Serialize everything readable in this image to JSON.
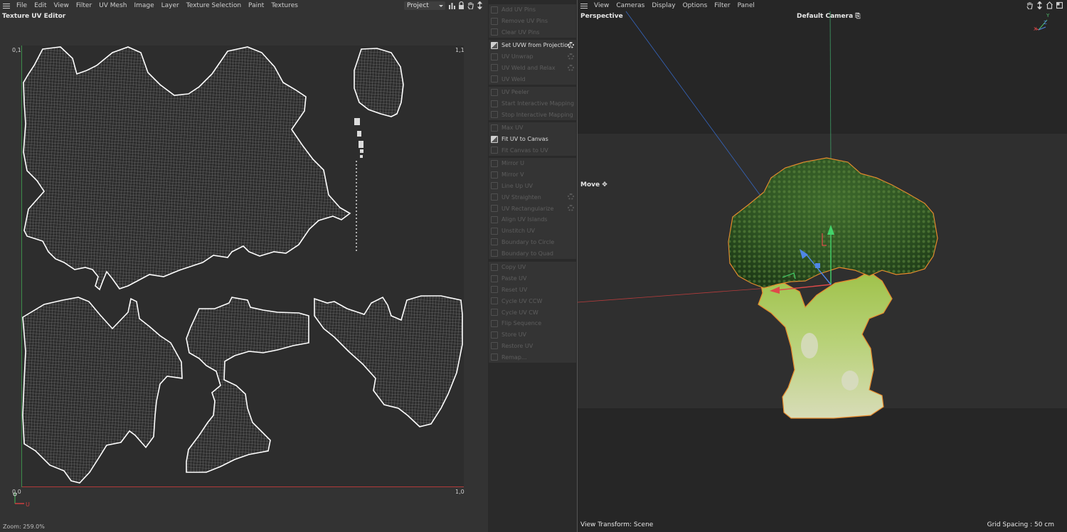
{
  "uv_editor": {
    "menu": [
      "File",
      "Edit",
      "View",
      "Filter",
      "UV Mesh",
      "Image",
      "Layer",
      "Texture Selection",
      "Paint",
      "Textures"
    ],
    "title": "Texture UV Editor",
    "project_select": "Project",
    "corners": {
      "top_left": "0,1",
      "top_right": "1,1",
      "bottom_left": "0,0",
      "bottom_right": "1,0"
    },
    "gizmo_u": "U",
    "zoom": "Zoom: 259.0%",
    "toolbar_icons": [
      "histogram-icon",
      "lock-icon",
      "hand-icon",
      "move-icon"
    ]
  },
  "commands": {
    "groups": [
      [
        {
          "label": "Add UV Pins",
          "active": false,
          "gear": false
        },
        {
          "label": "Remove UV Pins",
          "active": false,
          "gear": false
        },
        {
          "label": "Clear UV Pins",
          "active": false,
          "gear": false
        }
      ],
      [
        {
          "label": "Set UVW from Projection",
          "active": true,
          "gear": true
        },
        {
          "label": "UV Unwrap",
          "active": false,
          "gear": true
        },
        {
          "label": "UV Weld and Relax",
          "active": false,
          "gear": true
        },
        {
          "label": "UV Weld",
          "active": false,
          "gear": false
        }
      ],
      [
        {
          "label": "UV Peeler",
          "active": false,
          "gear": false
        },
        {
          "label": "Start Interactive Mapping",
          "active": false,
          "gear": false
        },
        {
          "label": "Stop Interactive Mapping",
          "active": false,
          "gear": false
        }
      ],
      [
        {
          "label": "Max UV",
          "active": false,
          "gear": false
        },
        {
          "label": "Fit UV to Canvas",
          "active": true,
          "gear": false
        },
        {
          "label": "Fit Canvas to UV",
          "active": false,
          "gear": false
        }
      ],
      [
        {
          "label": "Mirror U",
          "active": false,
          "gear": false
        },
        {
          "label": "Mirror V",
          "active": false,
          "gear": false
        },
        {
          "label": "Line Up UV",
          "active": false,
          "gear": false
        },
        {
          "label": "UV Straighten",
          "active": false,
          "gear": true
        },
        {
          "label": "UV Rectangularize",
          "active": false,
          "gear": true
        },
        {
          "label": "Align UV Islands",
          "active": false,
          "gear": false
        },
        {
          "label": "Unstitch UV",
          "active": false,
          "gear": false
        },
        {
          "label": "Boundary to Circle",
          "active": false,
          "gear": false
        },
        {
          "label": "Boundary to Quad",
          "active": false,
          "gear": false
        }
      ],
      [
        {
          "label": "Copy UV",
          "active": false,
          "gear": false
        },
        {
          "label": "Paste UV",
          "active": false,
          "gear": false
        },
        {
          "label": "Reset UV",
          "active": false,
          "gear": false
        },
        {
          "label": "Cycle UV CCW",
          "active": false,
          "gear": false
        },
        {
          "label": "Cycle UV CW",
          "active": false,
          "gear": false
        },
        {
          "label": "Flip Sequence",
          "active": false,
          "gear": false
        },
        {
          "label": "Store UV",
          "active": false,
          "gear": false
        },
        {
          "label": "Restore UV",
          "active": false,
          "gear": false
        },
        {
          "label": "Remap...",
          "active": false,
          "gear": false
        }
      ]
    ]
  },
  "viewport": {
    "menu": [
      "View",
      "Cameras",
      "Display",
      "Options",
      "Filter",
      "Panel"
    ],
    "view_name": "Perspective",
    "camera": "Default Camera",
    "camera_icon": "⎘",
    "tool": "Move",
    "tool_icon": "✥",
    "view_transform": "View Transform: Scene",
    "grid_spacing": "Grid Spacing : 50 cm",
    "axis_labels": {
      "x": "X",
      "y": "Y",
      "z": "Z"
    },
    "toolbar_icons": [
      "hand-icon",
      "move-icon",
      "home-icon",
      "maximize-icon"
    ]
  },
  "colors": {
    "u_axis": "#b13a3a",
    "v_axis": "#3c8c4a",
    "selection_outline": "#e88a2c",
    "broccoli_dark": "#2e5a22",
    "broccoli_light": "#b9d27a"
  }
}
